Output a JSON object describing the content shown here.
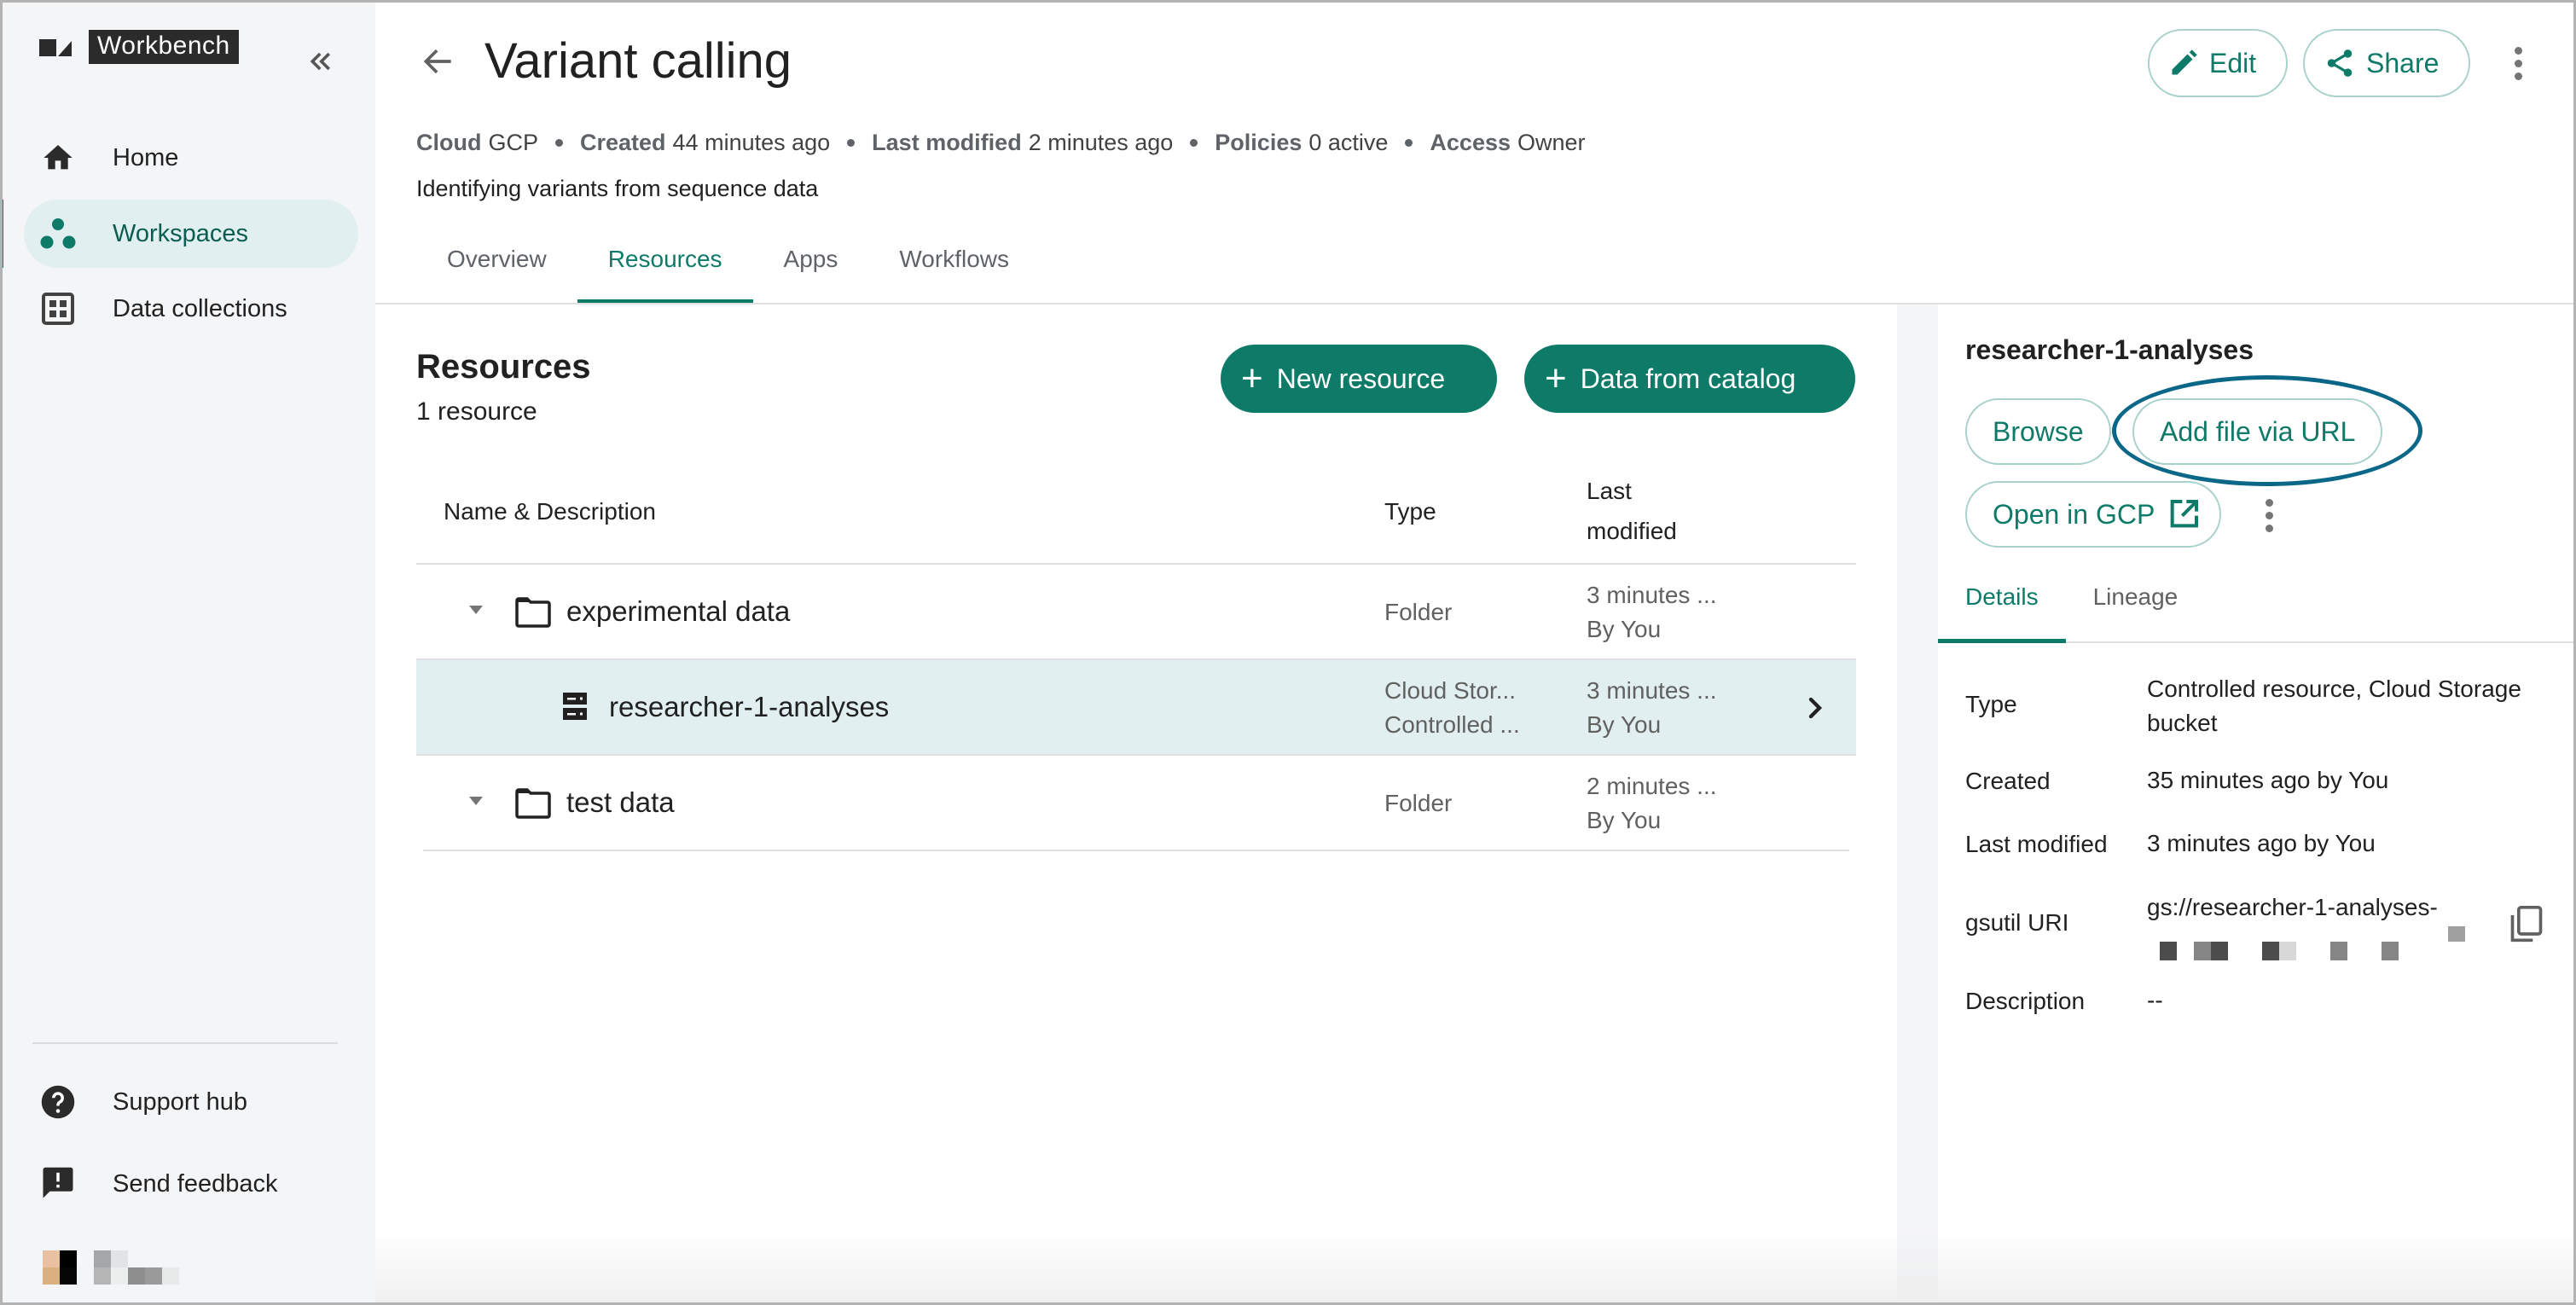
{
  "app": {
    "name": "Workbench",
    "collapse_icon": "double-chevron-left-icon"
  },
  "sidebar": {
    "items": [
      {
        "label": "Home",
        "icon": "home-icon",
        "active": false
      },
      {
        "label": "Workspaces",
        "icon": "workspaces-icon",
        "active": true
      },
      {
        "label": "Data collections",
        "icon": "grid-icon",
        "active": false
      }
    ],
    "bottom_items": [
      {
        "label": "Support hub",
        "icon": "help-circle-icon"
      },
      {
        "label": "Send feedback",
        "icon": "feedback-icon"
      }
    ]
  },
  "header": {
    "title": "Variant calling",
    "meta": [
      {
        "key": "Cloud",
        "value": "GCP"
      },
      {
        "key": "Created",
        "value": "44 minutes ago"
      },
      {
        "key": "Last modified",
        "value": "2 minutes ago"
      },
      {
        "key": "Policies",
        "value": "0 active"
      },
      {
        "key": "Access",
        "value": "Owner"
      }
    ],
    "description": "Identifying variants from sequence data",
    "actions": {
      "edit": "Edit",
      "share": "Share"
    },
    "tabs": [
      {
        "label": "Overview",
        "active": false
      },
      {
        "label": "Resources",
        "active": true
      },
      {
        "label": "Apps",
        "active": false
      },
      {
        "label": "Workflows",
        "active": false
      }
    ]
  },
  "resources": {
    "title": "Resources",
    "count": "1 resource",
    "buttons": {
      "new_resource": "New resource",
      "data_from_catalog": "Data from catalog"
    },
    "columns": {
      "name": "Name & Description",
      "type": "Type",
      "modified_line1": "Last",
      "modified_line2": "modified"
    },
    "rows": [
      {
        "name": "experimental data",
        "icon": "folder-icon",
        "type1": "Folder",
        "type2": "",
        "modified": "3 minutes ...",
        "by": "By You",
        "expanded": true,
        "level": 0,
        "selected": false
      },
      {
        "name": "researcher-1-analyses",
        "icon": "storage-bucket-icon",
        "type1": "Cloud Stor...",
        "type2": "Controlled ...",
        "modified": "3 minutes ...",
        "by": "By You",
        "level": 1,
        "selected": true
      },
      {
        "name": "test data",
        "icon": "folder-icon",
        "type1": "Folder",
        "type2": "",
        "modified": "2 minutes ...",
        "by": "By You",
        "expanded": true,
        "level": 0,
        "selected": false
      }
    ]
  },
  "panel": {
    "title": "researcher-1-analyses",
    "buttons": {
      "browse": "Browse",
      "add_file": "Add file via URL",
      "open_gcp": "Open in GCP"
    },
    "tabs": [
      {
        "label": "Details",
        "active": true
      },
      {
        "label": "Lineage",
        "active": false
      }
    ],
    "details": [
      {
        "label": "Type",
        "value": "Controlled resource, Cloud Storage bucket"
      },
      {
        "label": "Created",
        "value": "35 minutes ago by You"
      },
      {
        "label": "Last modified",
        "value": "3 minutes ago by You"
      },
      {
        "label": "gsutil URI",
        "value": "gs://researcher-1-analyses-"
      },
      {
        "label": "Description",
        "value": "--"
      }
    ]
  },
  "colors": {
    "accent": "#0e7a68",
    "selected_row": "#e1eff0",
    "sidebar_bg": "#f4f5f7",
    "highlight_ring": "#0b6787"
  }
}
